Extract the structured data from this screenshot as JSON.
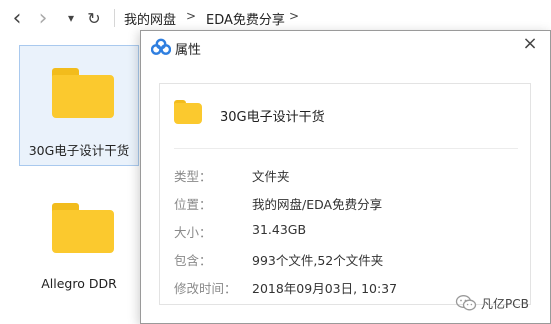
{
  "toolbar": {
    "icons": {
      "back": "chevron-left-icon",
      "forward": "chevron-right-icon",
      "history": "dropdown-triangle-icon",
      "refresh": "refresh-icon"
    },
    "back_glyph": "‹",
    "forward_glyph": "›",
    "history_glyph": "▾",
    "refresh_glyph": "↻",
    "breadcrumbs": [
      {
        "label": "我的网盘"
      },
      {
        "label": "EDA免费分享"
      }
    ],
    "crumb_separator": ">"
  },
  "files": [
    {
      "name": "30G电子设计干货",
      "icon": "folder-icon",
      "selected": true
    },
    {
      "name": "Allegro DDR",
      "icon": "folder-icon",
      "selected": false
    }
  ],
  "dialog": {
    "title": "属性",
    "icon": "baidu-cloud-icon",
    "close_glyph": "×",
    "item_name": "30G电子设计干货",
    "properties": [
      {
        "label": "类型：",
        "value": "文件夹"
      },
      {
        "label": "位置：",
        "value": "我的网盘/EDA免费分享"
      },
      {
        "label": "大小：",
        "value": "31.43GB"
      },
      {
        "label": "包含：",
        "value": "993个文件,52个文件夹"
      },
      {
        "label": "修改时间：",
        "value": "2018年09月03日, 10:37"
      }
    ]
  },
  "watermark": {
    "text": "凡亿PCB",
    "icon": "wechat-icon"
  },
  "colors": {
    "folder": "#fbc92e",
    "folder_tab": "#f2bc1c",
    "selection_bg": "#eaf2fb",
    "selection_border": "#a9c9ee",
    "cloud_icon": "#2f7fe0"
  }
}
